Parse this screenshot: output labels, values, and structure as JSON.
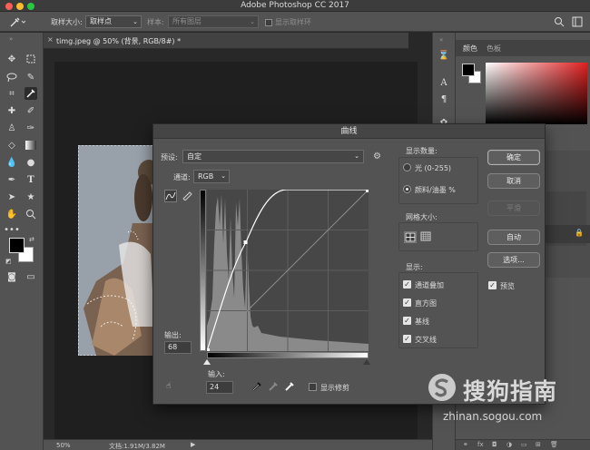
{
  "app": {
    "title": "Adobe Photoshop CC 2017"
  },
  "options_bar": {
    "sample_size_label": "取样大小:",
    "sample_size_value": "取样点",
    "sample_label": "样本:",
    "sample_value": "所有图层",
    "show_ring_label": "显示取样环"
  },
  "document": {
    "tab_title": "timg.jpeg @ 50% (背景, RGB/8#) *"
  },
  "status_bar": {
    "zoom": "50%",
    "doc_size": "文档:1.91M/3.82M"
  },
  "right_panel": {
    "tab_color": "颜色",
    "tab_swatches": "色板"
  },
  "curves_dialog": {
    "title": "曲线",
    "preset_label": "预设:",
    "preset_value": "自定",
    "channel_label": "通道:",
    "channel_value": "RGB",
    "output_label": "输出:",
    "output_value": "68",
    "input_label": "输入:",
    "input_value": "24",
    "show_clipping_label": "显示修剪",
    "display_amount": {
      "title": "显示数量:",
      "light_label": "光 (0-255)",
      "pigment_label": "颜料/油墨 %",
      "selected": "pigment"
    },
    "grid_size_title": "网格大小:",
    "show_title": "显示:",
    "show_options": [
      "通道叠加",
      "直方图",
      "基线",
      "交叉线"
    ],
    "buttons": {
      "ok": "确定",
      "cancel": "取消",
      "smooth": "平滑",
      "auto": "自动",
      "options": "选项..."
    },
    "preview_label": "预览"
  },
  "watermark": {
    "brand_text": "搜狗指南",
    "url": "zhinan.sogou.com"
  },
  "colors": {
    "ui_dark": "#535353",
    "canvas": "#282828",
    "dialog_bg": "#535353",
    "graph_bg": "#464646",
    "curve": "#ffffff"
  }
}
